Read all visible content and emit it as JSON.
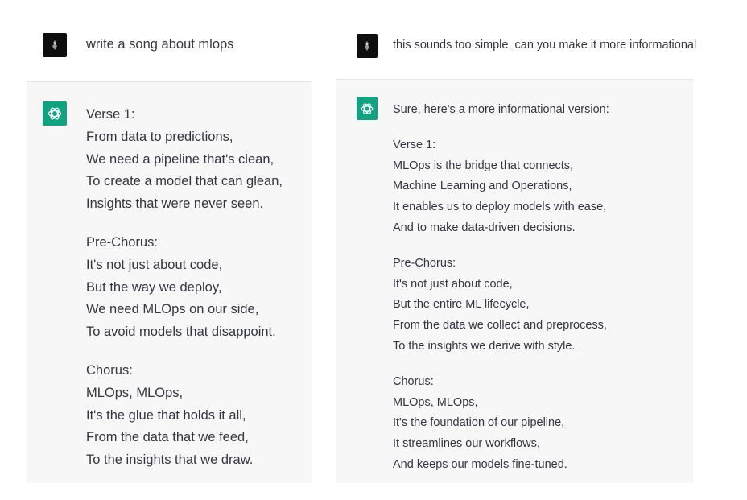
{
  "left": {
    "user_message": "write a song about mlops",
    "user_avatar": "user-avatar-dark-icon",
    "assistant_avatar": "openai-logo-icon",
    "response": {
      "stanzas": [
        {
          "heading": "Verse 1:",
          "lines": [
            "From data to predictions,",
            "We need a pipeline that's clean,",
            "To create a model that can glean,",
            "Insights that were never seen."
          ]
        },
        {
          "heading": "Pre-Chorus:",
          "lines": [
            "It's not just about code,",
            "But the way we deploy,",
            "We need MLOps on our side,",
            "To avoid models that disappoint."
          ]
        },
        {
          "heading": "Chorus:",
          "lines": [
            "MLOps, MLOps,",
            "It's the glue that holds it all,",
            "From the data that we feed,",
            "To the insights that we draw."
          ]
        }
      ]
    }
  },
  "right": {
    "user_message": "this sounds too simple, can you make it more informational",
    "user_avatar": "user-avatar-dark-icon",
    "assistant_avatar": "openai-logo-icon",
    "response": {
      "intro": "Sure, here's a more informational version:",
      "stanzas": [
        {
          "heading": "Verse 1:",
          "lines": [
            "MLOps is the bridge that connects,",
            "Machine Learning and Operations,",
            "It enables us to deploy models with ease,",
            "And to make data-driven decisions."
          ]
        },
        {
          "heading": "Pre-Chorus:",
          "lines": [
            "It's not just about code,",
            "But the entire ML lifecycle,",
            "From the data we collect and preprocess,",
            "To the insights we derive with style."
          ]
        },
        {
          "heading": "Chorus:",
          "lines": [
            "MLOps, MLOps,",
            "It's the foundation of our pipeline,",
            "It streamlines our workflows,",
            "And keeps our models fine-tuned."
          ]
        }
      ]
    }
  },
  "colors": {
    "assistant_bg": "#f7f7f8",
    "assistant_avatar_bg": "#10a37f",
    "text": "#343541",
    "user_avatar_bg": "#0e0e0e"
  }
}
